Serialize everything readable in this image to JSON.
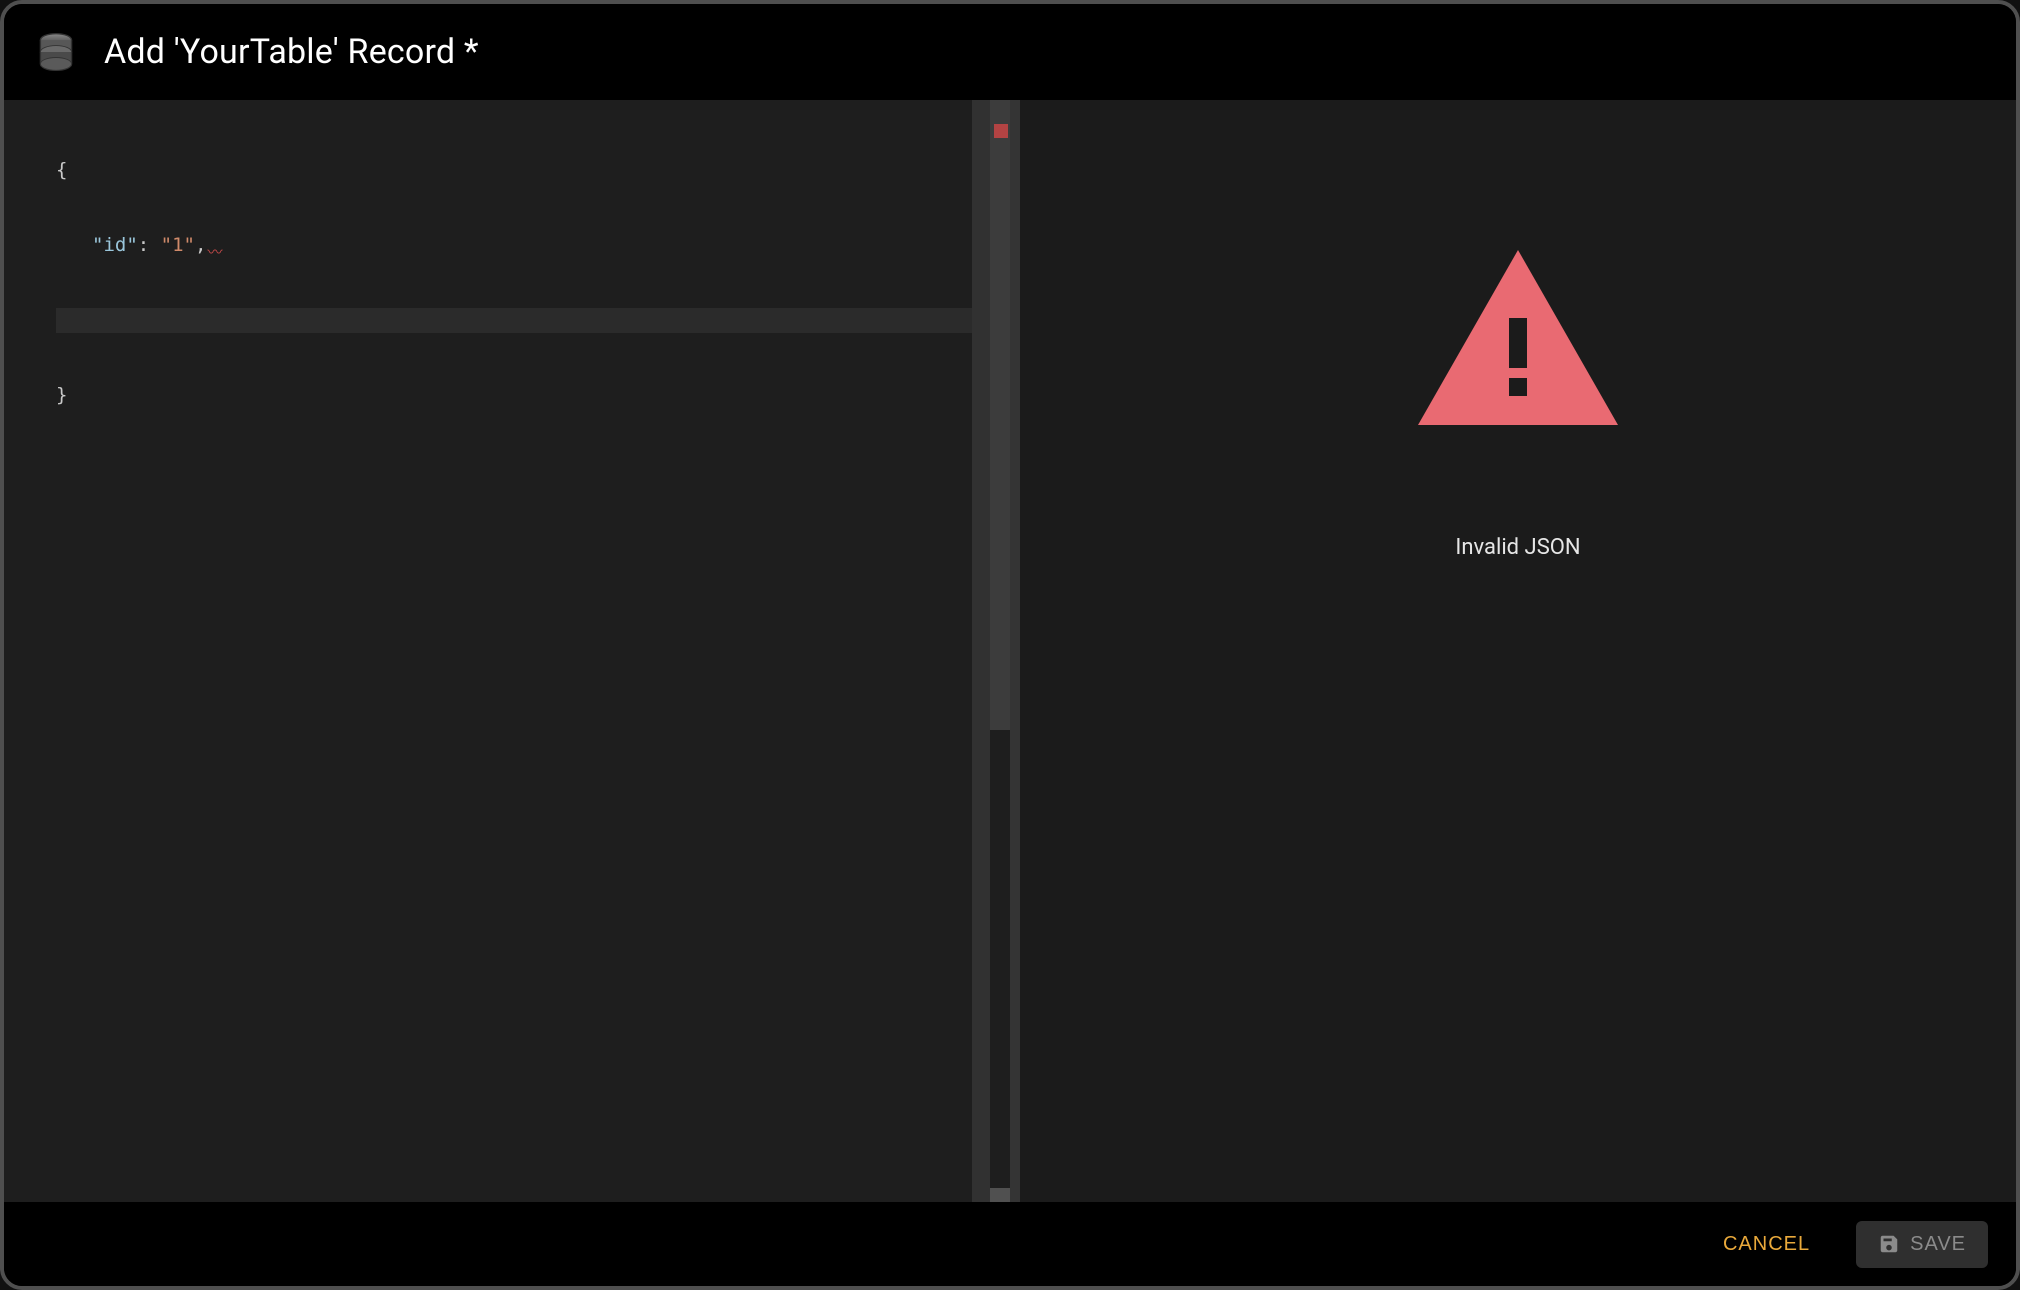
{
  "header": {
    "title": "Add 'YourTable' Record *"
  },
  "editor": {
    "lines": {
      "l1": "{",
      "l2_key": "\"id\"",
      "l2_colon": ": ",
      "l2_val": "\"1\"",
      "l2_trail": ",",
      "l3": "",
      "l4": "}"
    }
  },
  "preview": {
    "message": "Invalid JSON"
  },
  "footer": {
    "cancel_label": "CANCEL",
    "save_label": "SAVE"
  },
  "colors": {
    "accent": "#e9a93b",
    "error": "#e96a72"
  }
}
